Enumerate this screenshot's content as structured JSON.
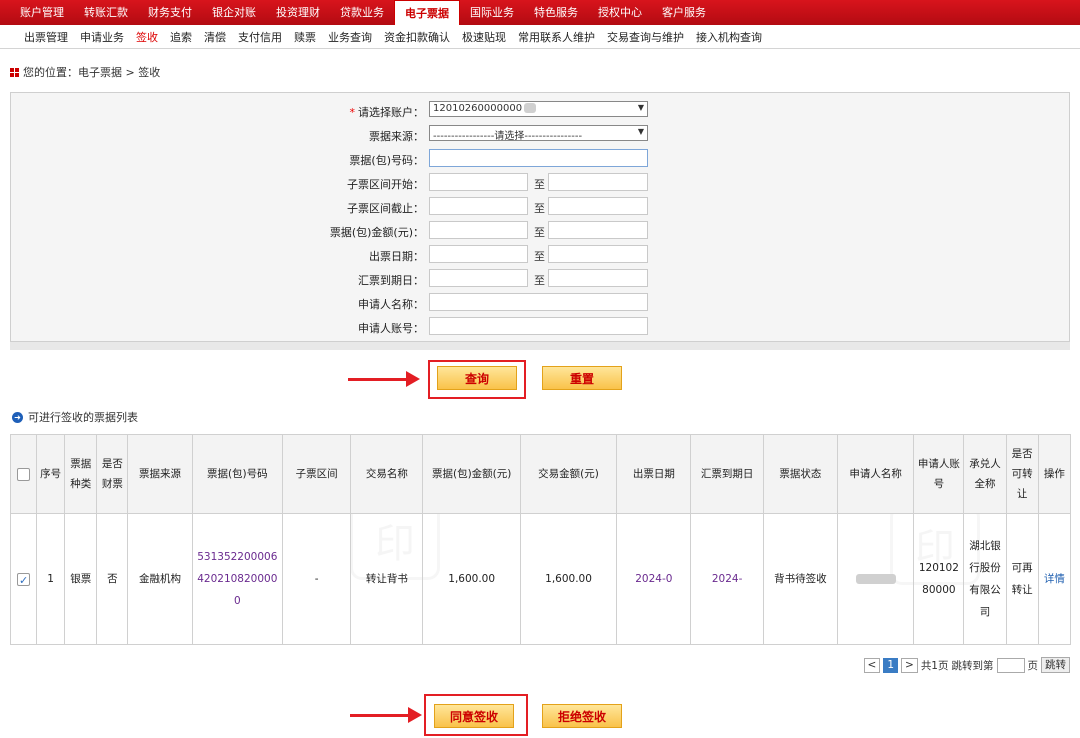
{
  "topnav": {
    "items": [
      "账户管理",
      "转账汇款",
      "财务支付",
      "银企对账",
      "投资理财",
      "贷款业务",
      "电子票据",
      "国际业务",
      "特色服务",
      "授权中心",
      "客户服务"
    ],
    "active_index": 6
  },
  "subnav": {
    "items": [
      "出票管理",
      "申请业务",
      "签收",
      "追索",
      "清偿",
      "支付信用",
      "赎票",
      "业务查询",
      "资金扣款确认",
      "极速贴现",
      "常用联系人维护",
      "交易查询与维护",
      "接入机构查询"
    ],
    "active_index": 2
  },
  "breadcrumb": "您的位置：电子票据 > 签收",
  "form": {
    "account_label": "请选择账户：",
    "account_value": "12010260000000",
    "source_label": "票据来源：",
    "source_value": "-----------------请选择----------------",
    "bill_no_label": "票据(包)号码：",
    "sub_start_label": "子票区间开始：",
    "sub_end_label": "子票区间截止：",
    "amount_label": "票据(包)金额(元)：",
    "issue_date_label": "出票日期：",
    "due_date_label": "汇票到期日：",
    "applicant_name_label": "申请人名称：",
    "applicant_acct_label": "申请人账号：",
    "to_label": "至"
  },
  "buttons": {
    "query": "查询",
    "reset": "重置",
    "agree": "同意签收",
    "reject": "拒绝签收"
  },
  "list_title": "可进行签收的票据列表",
  "table": {
    "headers": [
      "序号",
      "票据种类",
      "是否财票",
      "票据来源",
      "票据(包)号码",
      "子票区间",
      "交易名称",
      "票据(包)金额(元)",
      "交易金额(元)",
      "出票日期",
      "汇票到期日",
      "票据状态",
      "申请人名称",
      "申请人账号",
      "承兑人全称",
      "是否可转让",
      "操作"
    ],
    "rows": [
      {
        "checked": true,
        "seq": "1",
        "bill_type": "银票",
        "is_fin": "否",
        "source": "金融机构",
        "bill_no": "5313522000064202108200000",
        "sub_range": "-",
        "trade_name": "转让背书",
        "bill_amount": "1,600.00",
        "trade_amount": "1,600.00",
        "issue_date": "2024-0",
        "due_date": "2024-",
        "status": "背书待签收",
        "applicant_name": "",
        "applicant_acct": "12010280000",
        "acceptor": "湖北银行股份有限公司",
        "transferable": "可再转让",
        "action": "详情"
      }
    ]
  },
  "pager": {
    "prev": "<",
    "current": "1",
    "next": ">",
    "total": "共1页",
    "jump_prefix": "跳转到第",
    "jump_suffix": "页",
    "go": "跳转"
  },
  "colors": {
    "nav_red": "#c8101a",
    "accent_red": "#e31e24",
    "button_yellow": "#f9c24a",
    "link_purple": "#6a2a8f"
  }
}
